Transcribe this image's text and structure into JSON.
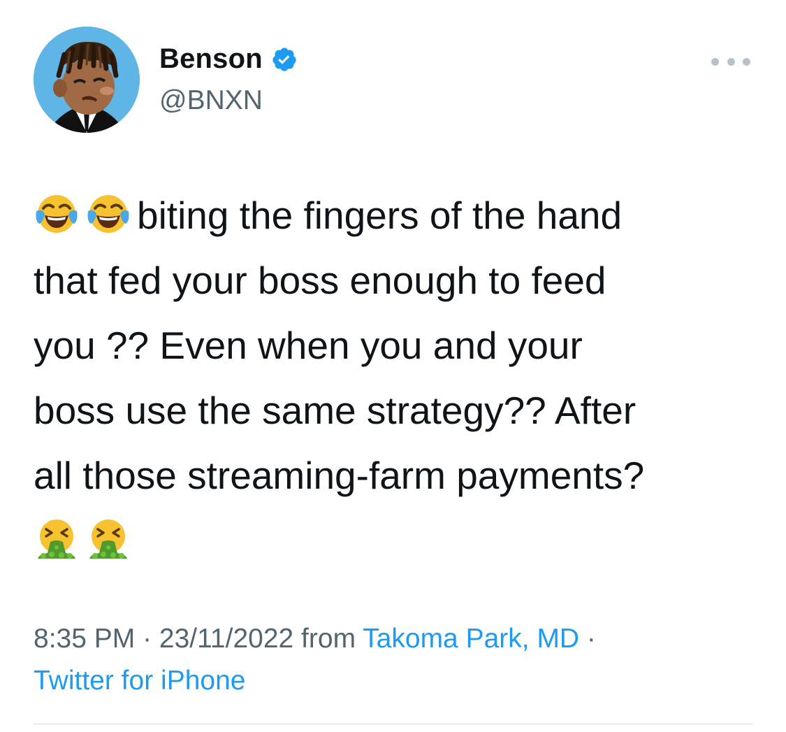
{
  "tweet": {
    "author": {
      "display_name": "Benson",
      "handle": "@BNXN",
      "verified": true,
      "verified_color": "#1d9bf0"
    },
    "more_icon": "more-options-icon",
    "text_lines": [
      {
        "emojis": [
          "face-with-tears-of-joy",
          "face-with-tears-of-joy"
        ],
        "text": "biting the fingers of the hand"
      },
      {
        "text": "that fed your boss enough to feed"
      },
      {
        "text": "you ?? Even when you and your"
      },
      {
        "text": "boss use the same strategy?? After"
      },
      {
        "text": "all those streaming-farm payments?"
      },
      {
        "emojis": [
          "face-vomiting",
          "face-vomiting"
        ],
        "text": ""
      }
    ],
    "meta": {
      "time": "8:35 PM",
      "sep1": " · ",
      "date": "23/11/2022",
      "from_label": " from ",
      "location": "Takoma Park, MD",
      "sep2": " · ",
      "source": "Twitter for iPhone"
    },
    "colors": {
      "text": "#0f1419",
      "secondary": "#536471",
      "link": "#1d9bf0",
      "avatar_bg": "#5fb6e6"
    }
  }
}
